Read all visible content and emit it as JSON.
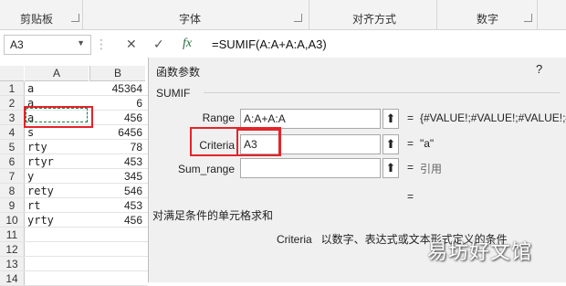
{
  "ribbon": {
    "groups": [
      {
        "label": "剪贴板"
      },
      {
        "label": "字体"
      },
      {
        "label": "对齐方式"
      },
      {
        "label": "数字"
      }
    ]
  },
  "formula_bar": {
    "name_box": "A3",
    "cancel_icon": "✕",
    "enter_icon": "✓",
    "fx_label": "fx",
    "formula": "=SUMIF(A:A+A:A,A3)"
  },
  "sheet": {
    "col_headers": [
      "A",
      "B"
    ],
    "rows": [
      {
        "n": "1",
        "a": "a",
        "b": "45364"
      },
      {
        "n": "2",
        "a": "a",
        "b": "6"
      },
      {
        "n": "3",
        "a": "a",
        "b": "456"
      },
      {
        "n": "4",
        "a": "s",
        "b": "6456"
      },
      {
        "n": "5",
        "a": "rty",
        "b": "78"
      },
      {
        "n": "6",
        "a": "rtyr",
        "b": "453"
      },
      {
        "n": "7",
        "a": "y",
        "b": "345"
      },
      {
        "n": "8",
        "a": "rety",
        "b": "546"
      },
      {
        "n": "9",
        "a": "rt",
        "b": "453"
      },
      {
        "n": "10",
        "a": "yrty",
        "b": "456"
      },
      {
        "n": "11",
        "a": "",
        "b": ""
      },
      {
        "n": "12",
        "a": "",
        "b": ""
      },
      {
        "n": "13",
        "a": "",
        "b": ""
      },
      {
        "n": "14",
        "a": "",
        "b": ""
      }
    ]
  },
  "dialog": {
    "title": "函数参数",
    "help": "?",
    "function_name": "SUMIF",
    "args": [
      {
        "label": "Range",
        "value": "A:A+A:A",
        "result": "{#VALUE!;#VALUE!;#VALUE!;#"
      },
      {
        "label": "Criteria",
        "value": "A3",
        "result": "\"a\""
      },
      {
        "label": "Sum_range",
        "value": "",
        "result": "引用"
      }
    ],
    "collapse_icon": "⬆",
    "eq": "=",
    "description": "对满足条件的单元格求和",
    "arg_help": "Criteria   以数字、表达式或文本形式定义的条件"
  },
  "watermark": "易坊好文馆"
}
